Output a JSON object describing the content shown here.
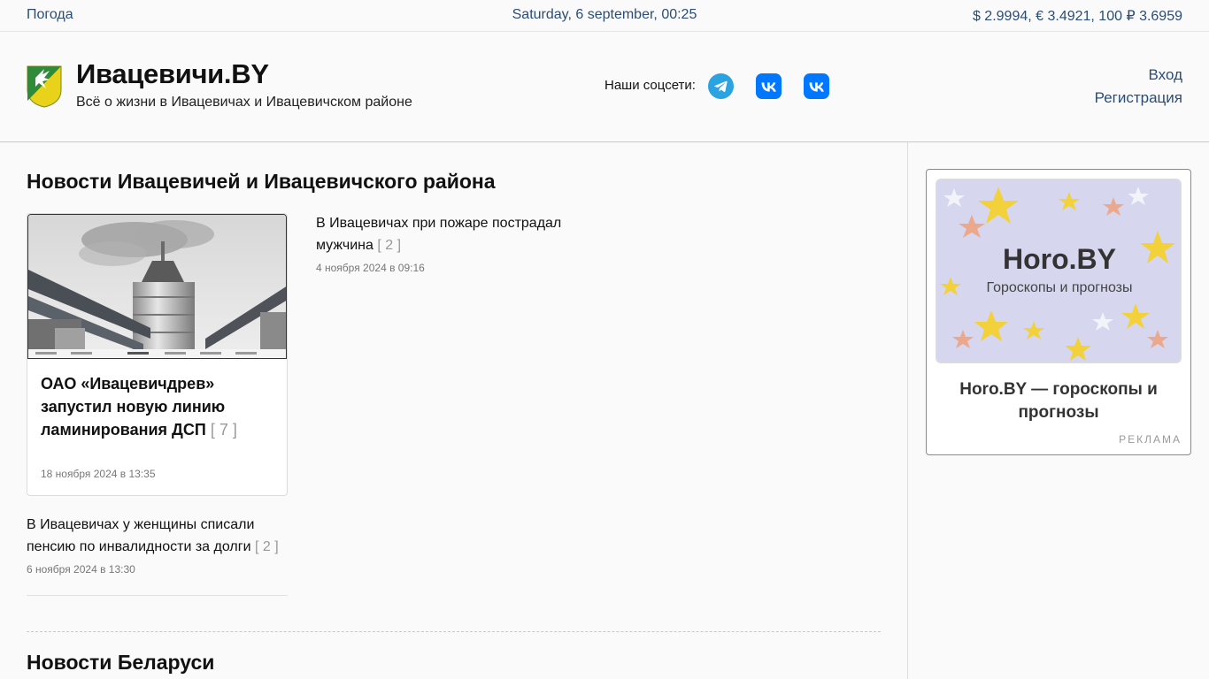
{
  "topbar": {
    "weather_link": "Погода",
    "datetime": "Saturday, 6 september, 00:25",
    "rates": "$ 2.9994, € 3.4921, 100 ₽ 3.6959"
  },
  "header": {
    "site_title": "Ивацевичи.BY",
    "tagline": "Всё о жизни в Ивацевичах и Ивацевичском районе",
    "social_label": "Наши соцсети:",
    "social_icons": [
      "telegram-icon",
      "vk-icon",
      "vk-icon"
    ],
    "login": "Вход",
    "register": "Регистрация"
  },
  "main": {
    "local_section_title": "Новости Ивацевичей и Ивацевичского района",
    "featured": {
      "title": "ОАО «Ивацевичдрев» запустил новую линию ламинирования ДСП",
      "comments": "[ 7 ]",
      "date": "18 ноября 2024 в 13:35"
    },
    "news": [
      {
        "title": "В Ивацевичах при пожаре пострадал мужчина",
        "comments": "[ 2 ]",
        "date": "4 ноября 2024 в 09:16"
      },
      {
        "title": "В Ивацевичах у женщины списали пенсию по инвалидности за долги",
        "comments": "[ 2 ]",
        "date": "6 ноября 2024 в 13:30"
      }
    ],
    "belarus_section_title": "Новости Беларуси"
  },
  "sidebar": {
    "ad": {
      "image_brand": "Horo.BY",
      "image_subtitle": "Гороскопы и прогнозы",
      "title": "Horo.BY — гороскопы и прогнозы",
      "label": "РЕКЛАМА"
    }
  },
  "colors": {
    "link": "#2c4d73",
    "telegram": "#2aa3e0",
    "vk": "#0077ff",
    "comments": "#999999"
  }
}
